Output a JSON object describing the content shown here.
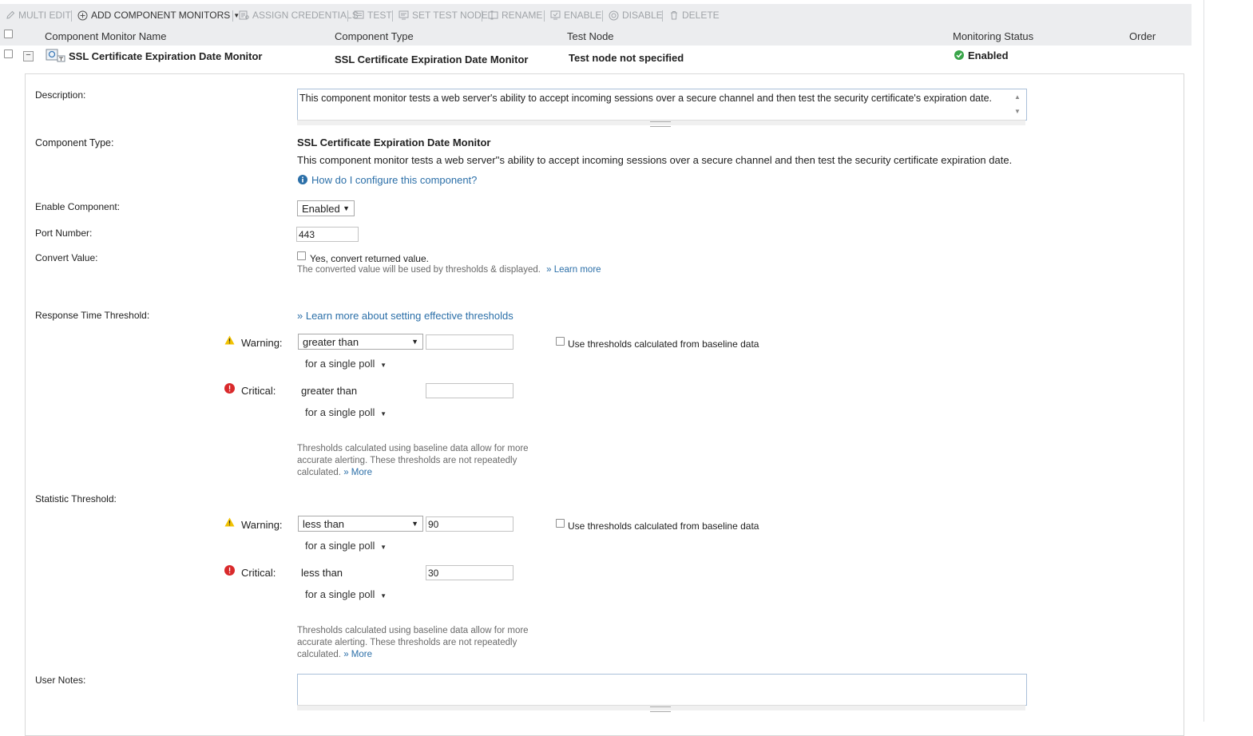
{
  "toolbar": {
    "multi_edit": "MULTI EDIT",
    "add_component_monitors": "ADD COMPONENT MONITORS",
    "assign_credentials": "ASSIGN CREDENTIALS",
    "test": "TEST",
    "set_test_node": "SET TEST NODE",
    "rename": "RENAME",
    "enable": "ENABLE",
    "disable": "DISABLE",
    "delete": "DELETE"
  },
  "table": {
    "headers": {
      "name": "Component Monitor Name",
      "type": "Component Type",
      "test_node": "Test Node",
      "status": "Monitoring Status",
      "order": "Order"
    },
    "row": {
      "name": "SSL Certificate Expiration Date Monitor",
      "type": "SSL Certificate Expiration Date Monitor",
      "test_node": "Test node not specified",
      "status": "Enabled"
    }
  },
  "details": {
    "description_label": "Description:",
    "description_value": "This component monitor tests a web server's ability to accept incoming sessions over a secure channel and then test the security certificate's expiration date.",
    "component_type_label": "Component Type:",
    "component_type_name": "SSL Certificate Expiration Date Monitor",
    "component_type_desc": "This component monitor tests a web server''s ability to accept incoming sessions over a secure channel and then test the security certificate expiration date.",
    "how_configure": "How do I configure this component?",
    "enable_label": "Enable Component:",
    "enable_value": "Enabled",
    "port_label": "Port Number:",
    "port_value": "443",
    "convert_label": "Convert Value:",
    "convert_checkbox": "Yes, convert returned value.",
    "convert_note": "The converted value will be used by thresholds & displayed.",
    "convert_learn_more": "» Learn more",
    "response_label": "Response Time Threshold:",
    "thresholds_link": "» Learn more about setting effective thresholds",
    "statistic_label": "Statistic Threshold:",
    "user_notes_label": "User Notes:",
    "user_notes_value": ""
  },
  "response_threshold": {
    "warning_label": "Warning:",
    "warning_op": "greater than",
    "warning_value": "",
    "warning_poll": "for a single poll",
    "critical_label": "Critical:",
    "critical_op": "greater than",
    "critical_value": "",
    "critical_poll": "for a single poll",
    "baseline_checkbox": "Use thresholds calculated from baseline data",
    "baseline_note": "Thresholds calculated using baseline data allow for more accurate alerting. These thresholds are not repeatedly calculated.",
    "more_link": "» More"
  },
  "statistic_threshold": {
    "warning_label": "Warning:",
    "warning_op": "less than",
    "warning_value": "90",
    "warning_poll": "for a single poll",
    "critical_label": "Critical:",
    "critical_op": "less than",
    "critical_value": "30",
    "critical_poll": "for a single poll",
    "baseline_checkbox": "Use thresholds calculated from baseline data",
    "baseline_note": "Thresholds calculated using baseline data allow for more accurate alerting. These thresholds are not repeatedly calculated.",
    "more_link": "» More"
  },
  "colors": {
    "link": "#2b6fa8",
    "enabled_green": "#3aa54a",
    "warning_yellow": "#f2c200",
    "critical_red": "#d9292b"
  }
}
